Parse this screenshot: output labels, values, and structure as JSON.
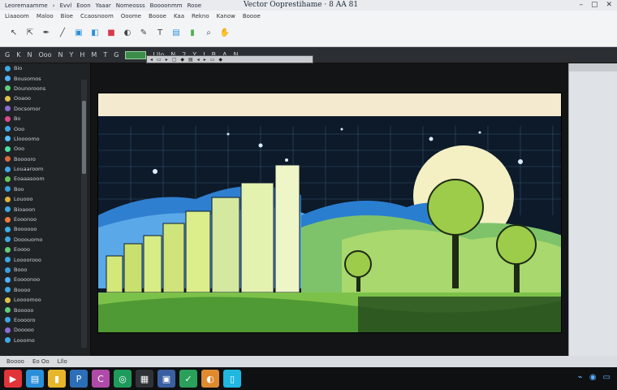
{
  "window": {
    "title": "Vector Ooprestihame · 8 AA 81",
    "menu": [
      "Leoremaamme",
      "›",
      "Evvl",
      "Eoon",
      "Yaaar",
      "Nomeosss",
      "Boooonmm",
      "Rooe"
    ]
  },
  "ribbon": {
    "tabs": [
      "Liaaoom",
      "Maloo",
      "Bioe",
      "Ccaosnoom",
      "Ooome",
      "Boooe",
      "Kaa",
      "Rekno",
      "Kanow",
      "Boooe"
    ]
  },
  "optbar": {
    "items": [
      "G",
      "K",
      "N",
      "Ooo",
      "N",
      "Y",
      "H",
      "M",
      "T",
      "G",
      "Lllo",
      "N",
      "2",
      "Y",
      "J",
      "B",
      "A",
      "N"
    ]
  },
  "layers": [
    {
      "label": "Bio",
      "color": "#3da9e8"
    },
    {
      "label": "Bousomos",
      "color": "#4fb3ff"
    },
    {
      "label": "Dounoroons",
      "color": "#5cd07a"
    },
    {
      "label": "Ooaoo",
      "color": "#e0c24a"
    },
    {
      "label": "Docsomor",
      "color": "#8e6cd8"
    },
    {
      "label": "Bo",
      "color": "#e04a8c"
    },
    {
      "label": "Ooo",
      "color": "#3da9e8"
    },
    {
      "label": "Lloooomo",
      "color": "#57c0ff"
    },
    {
      "label": "Ooo",
      "color": "#4be0a0"
    },
    {
      "label": "Booooro",
      "color": "#e06a3a"
    },
    {
      "label": "Louaaroom",
      "color": "#3fa9e8"
    },
    {
      "label": "Eoaaasoom",
      "color": "#67c85a"
    },
    {
      "label": "Boo",
      "color": "#3aa0e0"
    },
    {
      "label": "Louooo",
      "color": "#e0b23a"
    },
    {
      "label": "Bioaoon",
      "color": "#3da9e8"
    },
    {
      "label": "Eooonoo",
      "color": "#f07a3c"
    },
    {
      "label": "Boooooo",
      "color": "#3fb0e8"
    },
    {
      "label": "Dooouomo",
      "color": "#3da9e8"
    },
    {
      "label": "Eoooo",
      "color": "#5fd07a"
    },
    {
      "label": "Loooorooo",
      "color": "#3da9e8"
    },
    {
      "label": "Booo",
      "color": "#3aa0e0"
    },
    {
      "label": "Eoooonoo",
      "color": "#4fb3ff"
    },
    {
      "label": "Boooo",
      "color": "#3da9e8"
    },
    {
      "label": "Loooomoo",
      "color": "#e0c24a"
    },
    {
      "label": "Booooo",
      "color": "#5cd07a"
    },
    {
      "label": "Eooooro",
      "color": "#3da9e8"
    },
    {
      "label": "Dooooo",
      "color": "#8e6cd8"
    },
    {
      "label": "Looomo",
      "color": "#3da9e8"
    }
  ],
  "floatbar": {
    "items": [
      "◂",
      "▭",
      "▸",
      "▢",
      "◆",
      "▤",
      "◂",
      "▸",
      "▭",
      "◆"
    ]
  },
  "statusbar": {
    "items": [
      "Boooo",
      "Eo Oo",
      "Lllo"
    ]
  },
  "taskbar": {
    "apps": [
      {
        "icon": "▶",
        "color": "#e0343a"
      },
      {
        "icon": "▤",
        "color": "#2a8fd8"
      },
      {
        "icon": "▮",
        "color": "#e8b62a"
      },
      {
        "icon": "P",
        "color": "#2b6fb8"
      },
      {
        "icon": "C",
        "color": "#b04aa8"
      },
      {
        "icon": "◎",
        "color": "#1e9a5a"
      },
      {
        "icon": "▦",
        "color": "#2f3237"
      },
      {
        "icon": "▣",
        "color": "#3a5fa0"
      },
      {
        "icon": "✓",
        "color": "#2aa05a"
      },
      {
        "icon": "◐",
        "color": "#e08a30"
      },
      {
        "icon": "▯",
        "color": "#20b8e0"
      }
    ]
  }
}
